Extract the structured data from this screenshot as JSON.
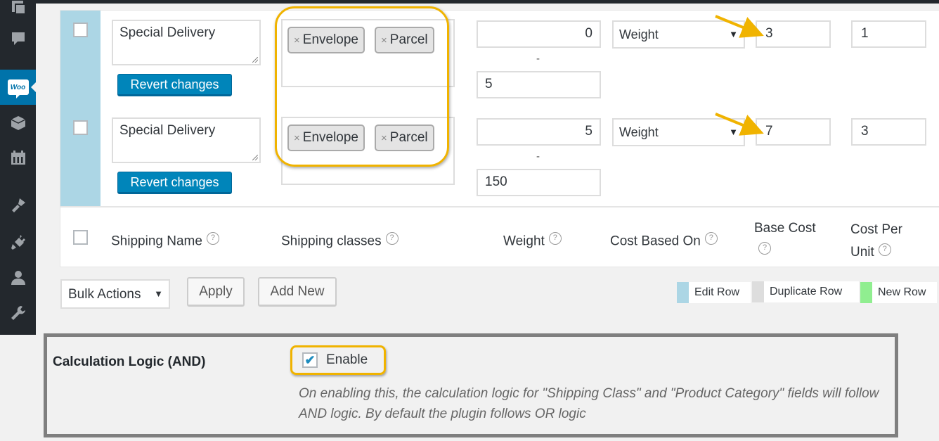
{
  "sidebar": {
    "items": [
      {
        "icon": "pages-icon"
      },
      {
        "icon": "comments-icon"
      },
      {
        "icon": "woocommerce-icon",
        "label": "Woo",
        "active": true
      },
      {
        "icon": "products-icon"
      },
      {
        "icon": "calendar-icon"
      },
      {
        "icon": "appearance-icon"
      },
      {
        "icon": "plugins-icon"
      },
      {
        "icon": "users-icon"
      },
      {
        "icon": "tools-icon"
      }
    ]
  },
  "rows": [
    {
      "shipping_name": "Special Delivery",
      "revert_label": "Revert changes",
      "classes": [
        {
          "remove": "×",
          "label": "Envelope"
        },
        {
          "remove": "×",
          "label": "Parcel"
        }
      ],
      "weight_min": "0",
      "weight_sep": "-",
      "weight_max": "5",
      "cost_based_on": "Weight",
      "base_cost": "3",
      "cost_per_unit": "1"
    },
    {
      "shipping_name": "Special Delivery",
      "revert_label": "Revert changes",
      "classes": [
        {
          "remove": "×",
          "label": "Envelope"
        },
        {
          "remove": "×",
          "label": "Parcel"
        }
      ],
      "weight_min": "5",
      "weight_sep": "-",
      "weight_max": "150",
      "cost_based_on": "Weight",
      "base_cost": "7",
      "cost_per_unit": "3"
    }
  ],
  "columns": {
    "shipping_name": "Shipping Name",
    "shipping_classes": "Shipping classes",
    "weight": "Weight",
    "cost_based_on": "Cost Based On",
    "base_cost": "Base Cost",
    "cost_per": "Cost Per",
    "unit": "Unit",
    "help": "?"
  },
  "actions": {
    "bulk_actions": "Bulk Actions",
    "apply": "Apply",
    "add_new": "Add New",
    "select_arrow": "▼"
  },
  "legend": [
    {
      "label": "Edit Row",
      "color": "#acd6e5"
    },
    {
      "label": "Duplicate Row",
      "color": "#dddddd"
    },
    {
      "label": "New Row",
      "color": "#90ee90"
    }
  ],
  "calculation_logic": {
    "label": "Calculation Logic (AND)",
    "checkbox_label": "Enable",
    "checked": true,
    "check_mark": "✔",
    "description": "On enabling this, the calculation logic for \"Shipping Class\" and \"Product Category\" fields will follow AND logic. By default the plugin follows OR logic"
  },
  "colors": {
    "accent": "#0085ba",
    "highlight": "#f0b300",
    "sidebar": "#23282d",
    "sidebar_active": "#0073aa"
  }
}
